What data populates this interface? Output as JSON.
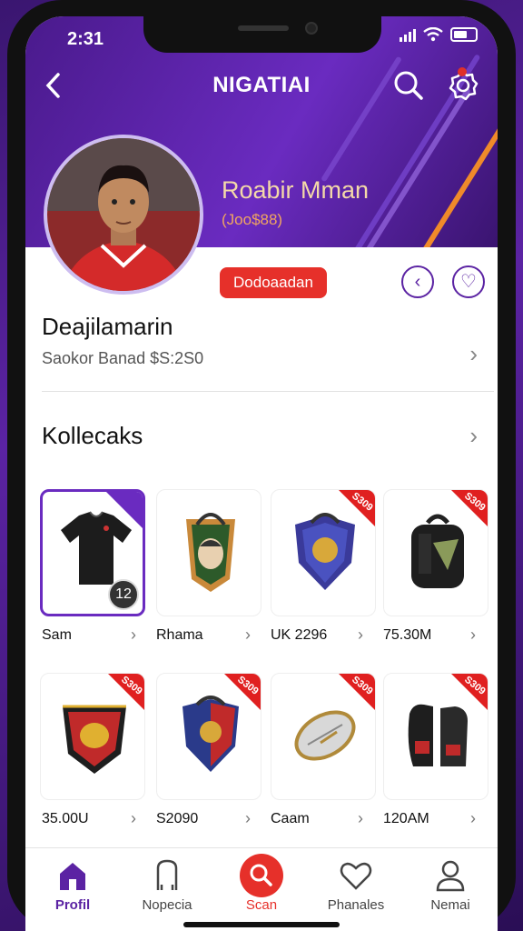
{
  "status": {
    "time": "2:31"
  },
  "navbar": {
    "title": "NIGATIAI"
  },
  "profile": {
    "name": "Roabir Mman",
    "subtitle": "(Joo$88)",
    "action_label": "Dodoaadan"
  },
  "account": {
    "title": "Deajilamarin",
    "subtitle": "Saokor Banad $S:2S0"
  },
  "collections": {
    "title": "Kollecaks",
    "items": [
      {
        "label": "Sam",
        "badge": "",
        "number": "12"
      },
      {
        "label": "Rhama",
        "badge": ""
      },
      {
        "label": "UK 2296",
        "badge": "S309"
      },
      {
        "label": "75.30M",
        "badge": "S309"
      },
      {
        "label": "35.00U",
        "badge": "S309"
      },
      {
        "label": "S2090",
        "badge": "S309"
      },
      {
        "label": "Caam",
        "badge": "S309"
      },
      {
        "label": "120AM",
        "badge": "S309"
      }
    ]
  },
  "tabs": [
    {
      "label": "Profil",
      "icon": "home-icon"
    },
    {
      "label": "Nopecia",
      "icon": "card-icon"
    },
    {
      "label": "Scan",
      "icon": "scan-icon"
    },
    {
      "label": "Phanales",
      "icon": "heart-icon"
    },
    {
      "label": "Nemai",
      "icon": "user-icon"
    }
  ],
  "colors": {
    "accent": "#5b23a3",
    "action": "#e6302a",
    "tag": "#e02020"
  }
}
